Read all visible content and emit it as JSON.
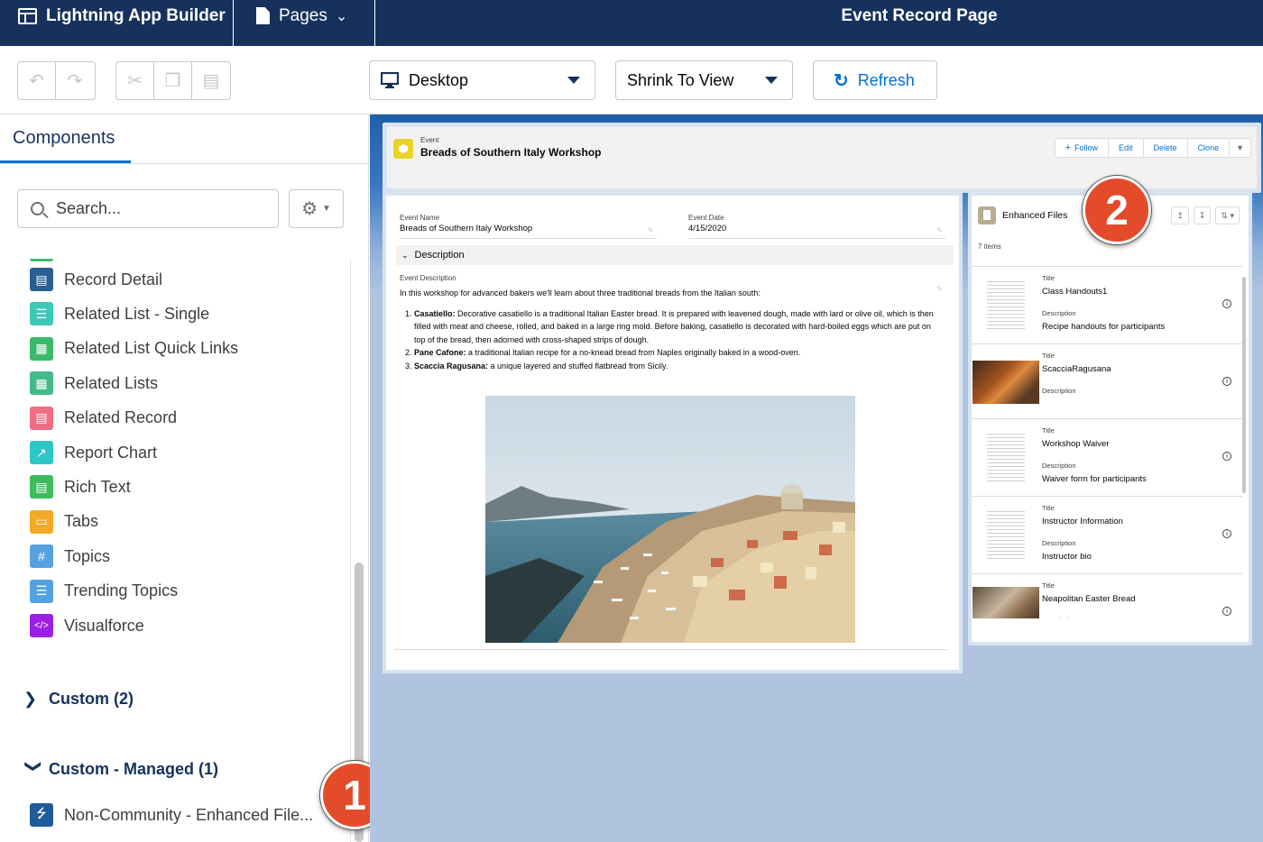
{
  "topbar": {
    "app_name": "Lightning App Builder",
    "pages_label": "Pages",
    "page_title": "Event Record Page"
  },
  "toolbar": {
    "device_select": "Desktop",
    "zoom_select": "Shrink To View",
    "refresh_label": "Refresh"
  },
  "left_panel": {
    "tab_label": "Components",
    "search_placeholder": "Search...",
    "components": [
      {
        "label": "Record Detail",
        "icon": "record-detail-icon",
        "color": "#2b5f8f"
      },
      {
        "label": "Related List - Single",
        "icon": "related-list-icon",
        "color": "#3dc9b7"
      },
      {
        "label": "Related List Quick Links",
        "icon": "quick-links-icon",
        "color": "#3bba6a"
      },
      {
        "label": "Related Lists",
        "icon": "related-lists-icon",
        "color": "#44b98a"
      },
      {
        "label": "Related Record",
        "icon": "related-record-icon",
        "color": "#ef6e84"
      },
      {
        "label": "Report Chart",
        "icon": "report-chart-icon",
        "color": "#2ec7c7"
      },
      {
        "label": "Rich Text",
        "icon": "rich-text-icon",
        "color": "#3ebc5c"
      },
      {
        "label": "Tabs",
        "icon": "tabs-icon",
        "color": "#f6a827"
      },
      {
        "label": "Topics",
        "icon": "topics-icon",
        "color": "#56a2e0"
      },
      {
        "label": "Trending Topics",
        "icon": "trending-topics-icon",
        "color": "#56a2e0"
      },
      {
        "label": "Visualforce",
        "icon": "visualforce-icon",
        "color": "#9b1fe4"
      }
    ],
    "section_custom": "Custom (2)",
    "section_managed": "Custom - Managed (1)",
    "managed_item": "Non-Community - Enhanced File..."
  },
  "callouts": {
    "one": "1",
    "two": "2"
  },
  "record": {
    "object_label": "Event",
    "title": "Breads of Southern Italy Workshop",
    "actions": {
      "follow": "Follow",
      "edit": "Edit",
      "delete": "Delete",
      "clone": "Clone"
    },
    "fields": {
      "name_label": "Event Name",
      "name_value": "Breads of Southern Italy Workshop",
      "date_label": "Event Date",
      "date_value": "4/15/2020"
    },
    "description_section": "Description",
    "description_label": "Event Description",
    "description_intro": "In this workshop for advanced bakers we'll learn about three traditional breads from the Italian south:",
    "breads": [
      {
        "name": "Casatiello:",
        "text": " Decorative casatiello is a traditional Italian Easter bread. It is prepared with leavened dough, made with lard or olive oil, which is then filled with meat and cheese, rolled, and baked in a large ring mold. Before baking, casatiello is decorated with hard-boiled eggs which are put on top of the bread, then adorned with cross-shaped strips of dough."
      },
      {
        "name": "Pane Cafone:",
        "text": " a traditional Italian recipe for a no-knead bread from Naples originally baked in a wood-oven."
      },
      {
        "name": "Scaccia Ragusana:",
        "text": " a unique layered and stuffed flatbread from Sicily."
      }
    ]
  },
  "enhanced_files": {
    "title": "Enhanced Files",
    "count": "7 items",
    "title_label": "Title",
    "desc_label": "Description",
    "files": [
      {
        "title": "Class Handouts1",
        "description": "Recipe handouts for participants",
        "thumb": "document"
      },
      {
        "title": "ScacciaRagusana",
        "description": "",
        "thumb": "photo-bread"
      },
      {
        "title": "Workshop Waiver",
        "description": "Waiver form for participants",
        "thumb": "document"
      },
      {
        "title": "Instructor Information",
        "description": "Instructor bio",
        "thumb": "document"
      },
      {
        "title": "Neapolitan Easter Bread",
        "description": "",
        "thumb": "photo-table"
      }
    ]
  }
}
